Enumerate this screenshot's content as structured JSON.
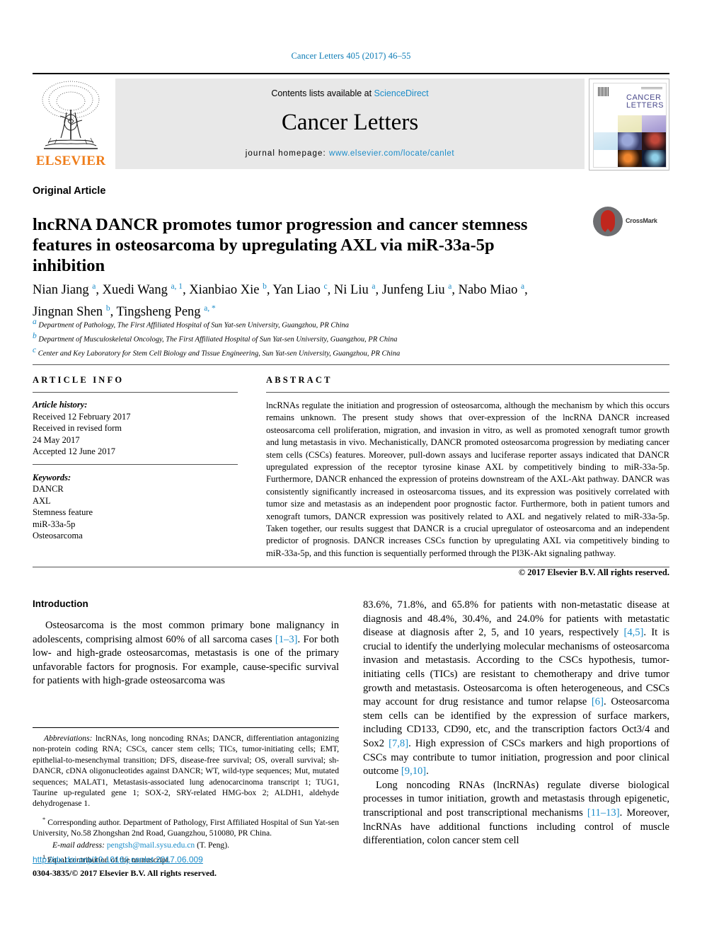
{
  "running_head": "Cancer Letters 405 (2017) 46–55",
  "masthead": {
    "contents_prefix": "Contents lists available at ",
    "sciencedirect": "ScienceDirect",
    "journal_title": "Cancer Letters",
    "homepage_label": "journal homepage: ",
    "homepage_url": "www.elsevier.com/locate/canlet",
    "publisher": "ELSEVIER",
    "cover_title_line1": "CANCER",
    "cover_title_line2": "LETTERS"
  },
  "article": {
    "type": "Original Article",
    "title": "lncRNA DANCR promotes tumor progression and cancer stemness features in osteosarcoma by upregulating AXL via miR-33a-5p inhibition",
    "crossmark_label": "CrossMark",
    "authors_line1_html": "Nian Jiang <sup>a</sup>, Xuedi Wang <sup>a, 1</sup>, Xianbiao Xie <sup>b</sup>, Yan Liao <sup>c</sup>, Ni Liu <sup>a</sup>, Junfeng Liu <sup>a</sup>, Nabo Miao <sup>a</sup>,",
    "authors_line2_html": "Jingnan Shen <sup>b</sup>, Tingsheng Peng <sup>a, *</sup>",
    "affiliations": [
      "Department of Pathology, The First Affiliated Hospital of Sun Yat-sen University, Guangzhou, PR China",
      "Department of Musculoskeletal Oncology, The First Affiliated Hospital of Sun Yat-sen University, Guangzhou, PR China",
      "Center and Key Laboratory for Stem Cell Biology and Tissue Engineering, Sun Yat-sen University, Guangzhou, PR China"
    ],
    "affiliation_marks": [
      "a",
      "b",
      "c"
    ]
  },
  "article_info": {
    "heading": "ARTICLE INFO",
    "history_label": "Article history:",
    "history_lines": [
      "Received 12 February 2017",
      "Received in revised form",
      "24 May 2017",
      "Accepted 12 June 2017"
    ],
    "keywords_label": "Keywords:",
    "keywords": [
      "DANCR",
      "AXL",
      "Stemness feature",
      "miR-33a-5p",
      "Osteosarcoma"
    ]
  },
  "abstract": {
    "heading": "ABSTRACT",
    "text": "lncRNAs regulate the initiation and progression of osteosarcoma, although the mechanism by which this occurs remains unknown. The present study shows that over-expression of the lncRNA DANCR increased osteosarcoma cell proliferation, migration, and invasion in vitro, as well as promoted xenograft tumor growth and lung metastasis in vivo. Mechanistically, DANCR promoted osteosarcoma progression by mediating cancer stem cells (CSCs) features. Moreover, pull-down assays and luciferase reporter assays indicated that DANCR upregulated expression of the receptor tyrosine kinase AXL by competitively binding to miR-33a-5p. Furthermore, DANCR enhanced the expression of proteins downstream of the AXL-Akt pathway. DANCR was consistently significantly increased in osteosarcoma tissues, and its expression was positively correlated with tumor size and metastasis as an independent poor prognostic factor. Furthermore, both in patient tumors and xenograft tumors, DANCR expression was positively related to AXL and negatively related to miR-33a-5p. Taken together, our results suggest that DANCR is a crucial upregulator of osteosarcoma and an independent predictor of prognosis. DANCR increases CSCs function by upregulating AXL via competitively binding to miR-33a-5p, and this function is sequentially performed through the PI3K-Akt signaling pathway.",
    "copyright": "© 2017 Elsevier B.V. All rights reserved."
  },
  "body": {
    "introduction_heading": "Introduction",
    "left_paragraph_html": "Osteosarcoma is the most common primary bone malignancy in adolescents, comprising almost 60% of all sarcoma cases <span class=\"cite\">[1–3]</span>. For both low- and high-grade osteosarcomas, metastasis is one of the primary unfavorable factors for prognosis. For example, cause-specific survival for patients with high-grade osteosarcoma was",
    "right_paragraph1_html": "83.6%, 71.8%, and 65.8% for patients with non-metastatic disease at diagnosis and 48.4%, 30.4%, and 24.0% for patients with metastatic disease at diagnosis after 2, 5, and 10 years, respectively <span class=\"cite\">[4,5]</span>. It is crucial to identify the underlying molecular mechanisms of osteosarcoma invasion and metastasis. According to the CSCs hypothesis, tumor-initiating cells (TICs) are resistant to chemotherapy and drive tumor growth and metastasis. Osteosarcoma is often heterogeneous, and CSCs may account for drug resistance and tumor relapse <span class=\"cite\">[6]</span>. Osteosarcoma stem cells can be identified by the expression of surface markers, including CD133, CD90, etc, and the transcription factors Oct3/4 and Sox2 <span class=\"cite\">[7,8]</span>. High expression of CSCs markers and high proportions of CSCs may contribute to tumor initiation, progression and poor clinical outcome <span class=\"cite\">[9,10]</span>.",
    "right_paragraph2_html": "Long noncoding RNAs (lncRNAs) regulate diverse biological processes in tumor initiation, growth and metastasis through epigenetic, transcriptional and post transcriptional mechanisms <span class=\"cite\">[11–13]</span>. Moreover, lncRNAs have additional functions including control of muscle differentiation, colon cancer stem cell"
  },
  "footnotes": {
    "abbreviations_label": "Abbreviations:",
    "abbreviations_text": "lncRNAs, long noncoding RNAs; DANCR, differentiation antagonizing non-protein coding RNA; CSCs, cancer stem cells; TICs, tumor-initiating cells; EMT, epithelial-to-mesenchymal transition; DFS, disease-free survival; OS, overall survival; sh-DANCR, cDNA oligonucleotides against DANCR; WT, wild-type sequences; Mut, mutated sequences; MALAT1, Metastasis-associated lung adenocarcinoma transcript 1; TUG1, Taurine up-regulated gene 1; SOX-2, SRY-related HMG-box 2; ALDH1, aldehyde dehydrogenase 1.",
    "corresponding_marker": "*",
    "corresponding_text": "Corresponding author. Department of Pathology, First Affiliated Hospital of Sun Yat-sen University, No.58 Zhongshan 2nd Road, Guangzhou, 510080, PR China.",
    "email_label": "E-mail address:",
    "email": "pengtsh@mail.sysu.edu.cn",
    "email_suffix": "(T. Peng).",
    "equal_marker": "1",
    "equal_text": "Equal contribution of the manuscript."
  },
  "footer": {
    "doi": "http://dx.doi.org/10.1016/j.canlet.2017.06.009",
    "issn_line": "0304-3835/© 2017 Elsevier B.V. All rights reserved."
  },
  "colors": {
    "link": "#1a8cc9",
    "running_head": "#0b7bb5",
    "elsevier_orange": "#ef7d1a",
    "panel_grey": "#e8e8e8",
    "crossmark_red": "#c0271d"
  }
}
